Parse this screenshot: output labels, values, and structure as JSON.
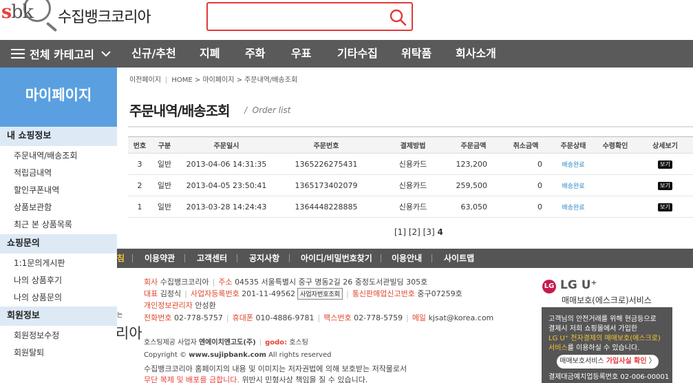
{
  "header": {
    "logo_text": "수집뱅크코리아",
    "search": {
      "value": "",
      "placeholder": ""
    }
  },
  "nav": {
    "all_category": "전체 카테고리",
    "items": [
      "신규/추천",
      "지폐",
      "주화",
      "우표",
      "기타수집",
      "위탁품",
      "회사소개"
    ]
  },
  "sidebar": {
    "title": "마이페이지",
    "sections": [
      {
        "title": "내 쇼핑정보",
        "items": [
          "주문내역/배송조회",
          "적립금내역",
          "할인쿠폰내역",
          "상품보관함",
          "최근 본 상품목록"
        ]
      },
      {
        "title": "쇼핑문의",
        "items": [
          "1:1문의게시판",
          "나의 상품후기",
          "나의 상품문의"
        ]
      },
      {
        "title": "회원정보",
        "items": [
          "회원정보수정",
          "회원탈퇴"
        ]
      }
    ]
  },
  "breadcrumb": {
    "prev": "이전페이지",
    "path": "HOME > 마이페이지 > 주문내역/배송조회"
  },
  "page": {
    "title": "주문내역/배송조회",
    "subtitle": "Order list"
  },
  "table": {
    "headers": [
      "번호",
      "구분",
      "주문일시",
      "주문번호",
      "결제방법",
      "주문금액",
      "취소금액",
      "주문상태",
      "수령확인",
      "상세보기"
    ],
    "rows": [
      {
        "no": "3",
        "type": "일반",
        "date": "2013-04-06 14:31:35",
        "order_no": "1365226275431",
        "pay": "신용카드",
        "amount": "123,200",
        "cancel": "0",
        "status": "배송완료",
        "receipt": "",
        "detail": "보기"
      },
      {
        "no": "2",
        "type": "일반",
        "date": "2013-04-05 23:50:41",
        "order_no": "1365173402079",
        "pay": "신용카드",
        "amount": "259,500",
        "cancel": "0",
        "status": "배송완료",
        "receipt": "",
        "detail": "보기"
      },
      {
        "no": "1",
        "type": "일반",
        "date": "2013-03-28 14:24:43",
        "order_no": "1364448228885",
        "pay": "신용카드",
        "amount": "63,050",
        "cancel": "0",
        "status": "배송완료",
        "receipt": "",
        "detail": "보기"
      }
    ]
  },
  "pagination": {
    "pages": [
      "[1]",
      "[2]",
      "[3]"
    ],
    "current": "4"
  },
  "footer": {
    "links": [
      "침",
      "이용약관",
      "고객센터",
      "공지사항",
      "아이디/비밀번호찾기",
      "이용안내",
      "사이트맵"
    ],
    "company_label": "회사",
    "company": "수집뱅크코리아",
    "address_label": "주소",
    "address": "04535 서울특별시 중구 명동2길 26 중정도서관빌딩 305호",
    "ceo_label": "대표",
    "ceo": "김정식",
    "biz_label": "사업자등록번호",
    "biz_no": "201-11-49562",
    "biz_btn": "사업자번호조회",
    "mail_order_label": "통신판매업신고번호",
    "mail_order": "중구07259호",
    "privacy_label": "개인정보관리자",
    "privacy": "안성환",
    "phone_label": "전화번호",
    "phone": "02-778-5757",
    "mobile_label": "휴대폰",
    "mobile": "010-4886-9781",
    "fax_label": "팩스번호",
    "fax": "02-778-5759",
    "email_label": "메일",
    "email": "kjsat@korea.com",
    "hosting_label": "호스팅제공 사업자",
    "hosting": "엔에이치엔고도(주)",
    "godo": "godo:",
    "godo_suffix": "호스팅",
    "copyright_prefix": "Copyright ©",
    "copyright_site": "www.sujipbank.com",
    "copyright_suffix": "All rights reserved",
    "notice1": "수집뱅크코리아 홈페이지의 내용 및 이미지는 저자권법에 의해 보호받는 저작물로서",
    "notice2_red": "무단 복제 및 배포를 금합니다.",
    "notice2": "위반시 민형사상 책임을 질 수 있습니다.",
    "logo_frag1": "는",
    "logo_frag2": "리아"
  },
  "lg": {
    "circle": "LG",
    "name": "LG U⁺",
    "service": "매매보호(에스크로)서비스",
    "line1": "고객님의 안전거래를 위해 현금등으로",
    "line2": "결제시 저희 쇼핑몰에서 가입한",
    "line3": "LG U⁺ 전자결제의 매매보호(에스크로)",
    "line4_hl": "서비스",
    "line4": "를 이용하실 수 있습니다.",
    "btn_prefix": "매매보호서비스",
    "btn_hl": "가입사실 확인",
    "btn_suffix": "〉",
    "reg": "결제대금예치업등록번호 02-006-00001"
  },
  "colors": {
    "accent_red": "#e23939",
    "sidebar_blue": "#5aa0e0",
    "nav_gray": "#5a5a5a",
    "link_blue": "#2e8bcc",
    "footer_gold": "#f2c433"
  }
}
